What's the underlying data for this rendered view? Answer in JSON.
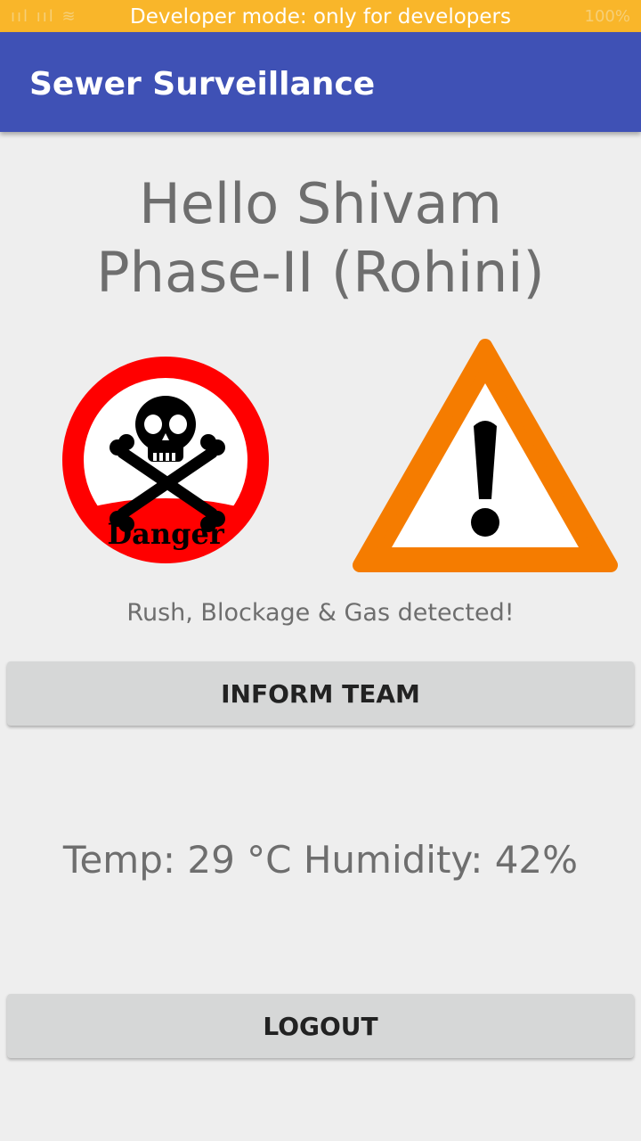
{
  "status_bar": {
    "banner": "Developer mode: only for developers",
    "left_icons": "ııl ııl ≋",
    "battery_text": "100%",
    "background": "#f9b62a"
  },
  "app_bar": {
    "title": "Sewer Surveillance",
    "background": "#3f51b5"
  },
  "main": {
    "greeting_line1": "Hello Shivam",
    "greeting_line2": "Phase-II (Rohini)",
    "danger_icon": "danger-skull-icon",
    "danger_label": "Danger",
    "warning_icon": "warning-triangle-icon",
    "alert_message": "Rush, Blockage & Gas detected!",
    "inform_button": "INFORM TEAM",
    "sensor_readout": "Temp: 29 °C Humidity: 42%",
    "logout_button": "LOGOUT"
  },
  "colors": {
    "danger_red": "#ff0000",
    "warning_orange": "#f57c00",
    "button_bg": "#d6d7d7",
    "text_gray": "#6e6e6e"
  }
}
